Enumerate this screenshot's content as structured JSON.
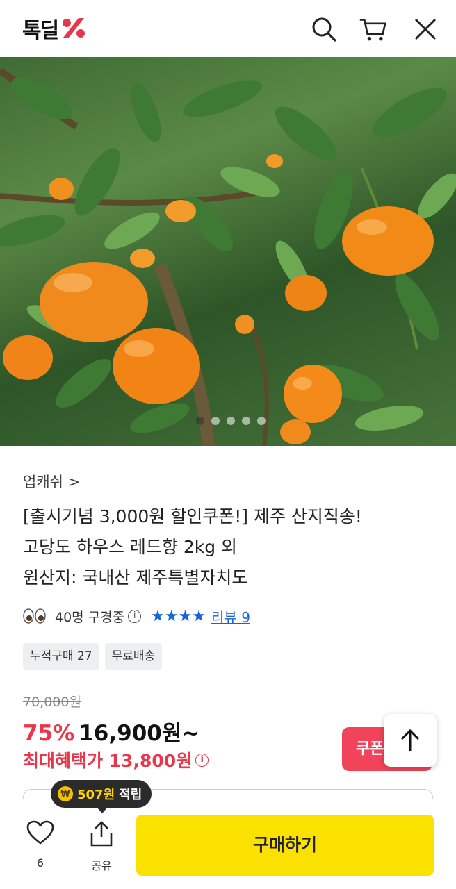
{
  "header": {
    "logo_text": "톡딜",
    "logo_icon": "percent-logo-icon",
    "search_icon": "search-icon",
    "cart_icon": "cart-icon",
    "close_icon": "close-icon"
  },
  "hero": {
    "carousel_total": 5,
    "carousel_active": 1
  },
  "product": {
    "seller": "업캐쉬 >",
    "title_line1": "[출시기념 3,000원 할인쿠폰!] 제주 산지직송!",
    "title_line2": "고당도 하우스 레드향 2kg 외",
    "title_line3": "원산지: 국내산 제주특별자치도",
    "viewers": "40명 구경중",
    "info_icon": "info-icon",
    "rating_stars": "★★★★",
    "review_label": "리뷰 9",
    "chips": [
      "누적구매 27",
      "무료배송"
    ],
    "original_price": "70,000원",
    "discount": "75%",
    "price": "16,900원~",
    "max_benefit": "최대혜택가 13,800원"
  },
  "actions": {
    "coupon_label": "쿠폰",
    "top_icon": "arrow-up-icon"
  },
  "bottom_bar": {
    "points_amount": "507원",
    "points_label": "적립",
    "coin_symbol": "₩",
    "like_count": "6",
    "share_label": "공유",
    "buy_label": "구매하기"
  },
  "colors": {
    "accent_red": "#e8374b",
    "link_blue": "#1565d8",
    "buy_yellow": "#fae100",
    "coupon_red": "#f1445a"
  }
}
